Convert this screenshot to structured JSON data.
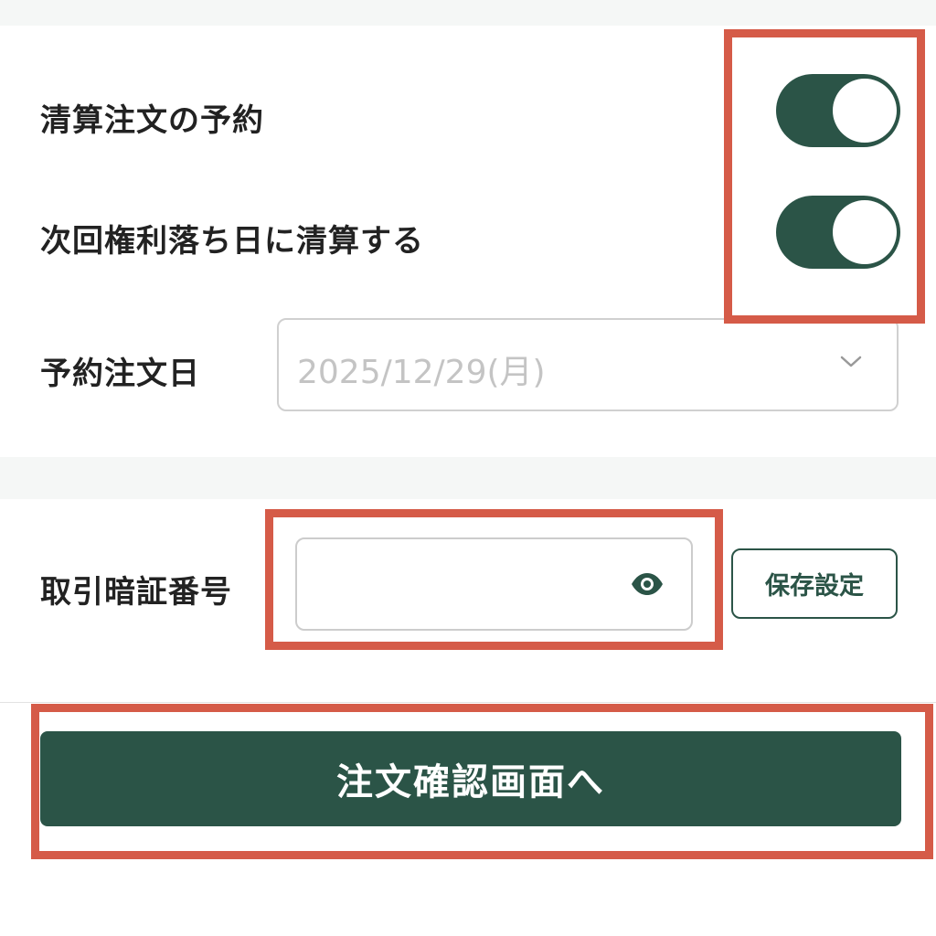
{
  "settings": {
    "reserve_settlement_label": "清算注文の予約",
    "reserve_settlement_on": true,
    "settle_next_exright_label": "次回権利落ち日に清算する",
    "settle_next_exright_on": true,
    "order_date_label": "予約注文日",
    "order_date_value": "2025/12/29(月)"
  },
  "pin": {
    "label": "取引暗証番号",
    "value": "",
    "reveal_icon": "eye-icon",
    "save_label": "保存設定"
  },
  "submit": {
    "label": "注文確認画面へ"
  },
  "colors": {
    "accent": "#2b5447",
    "highlight": "#d55b48",
    "band": "#f5f7f6"
  }
}
